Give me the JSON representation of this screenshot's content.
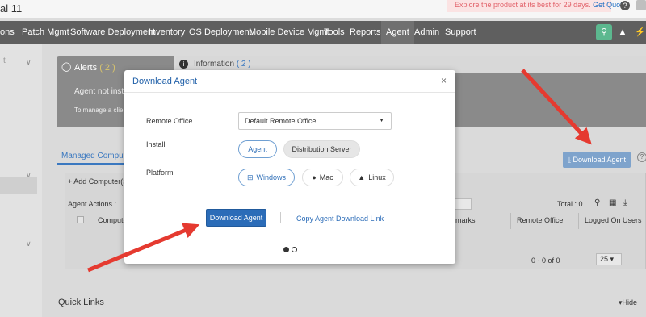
{
  "app": {
    "title": "al 11"
  },
  "promo": {
    "text": "Explore the product at its best for 29 days.",
    "link": "Get Quote"
  },
  "header": {
    "help_glyph": "?"
  },
  "nav": {
    "items": [
      "ons",
      "Patch Mgmt",
      "Software Deployment",
      "Inventory",
      "OS Deployment",
      "Mobile Device Mgmt",
      "Tools",
      "Reports",
      "Agent",
      "Admin",
      "Support"
    ],
    "active": "Agent"
  },
  "alerts": {
    "title": "Alerts",
    "count": "( 2 )",
    "message": "Agent not insta",
    "sub": "To manage a client"
  },
  "information": {
    "title": "Information",
    "count": "( 2 )"
  },
  "tabs": {
    "managed_computers": "Managed Computers"
  },
  "bg_download_button": "Download Agent",
  "grid": {
    "add_computers": "+ Add Computer(s",
    "agent_actions": "Agent Actions :",
    "total": "Total : 0",
    "columns": {
      "computer": "Compute",
      "remarks": "marks",
      "remote_office": "Remote Office",
      "logged_on": "Logged On Users"
    },
    "pager": "0 - 0 of 0",
    "page_size": "25"
  },
  "quick_links": {
    "title": "Quick Links",
    "hide": "Hide"
  },
  "modal": {
    "title": "Download Agent",
    "close_glyph": "×",
    "remote_office_label": "Remote Office",
    "remote_office_value": "Default Remote Office",
    "install_label": "Install",
    "install_options": {
      "agent": "Agent",
      "distribution": "Distribution Server"
    },
    "platform_label": "Platform",
    "platform_options": {
      "windows": "Windows",
      "mac": "Mac",
      "linux": "Linux"
    },
    "download_button": "Download Agent",
    "copy_link": "Copy Agent Download Link"
  },
  "colors": {
    "nav_bg": "#5f5f5f",
    "primary": "#2b6cb8",
    "link": "#2b6cb8",
    "promo_text": "#e2626a",
    "search_green": "#5cb88f",
    "arrow_red": "#e53a30"
  }
}
